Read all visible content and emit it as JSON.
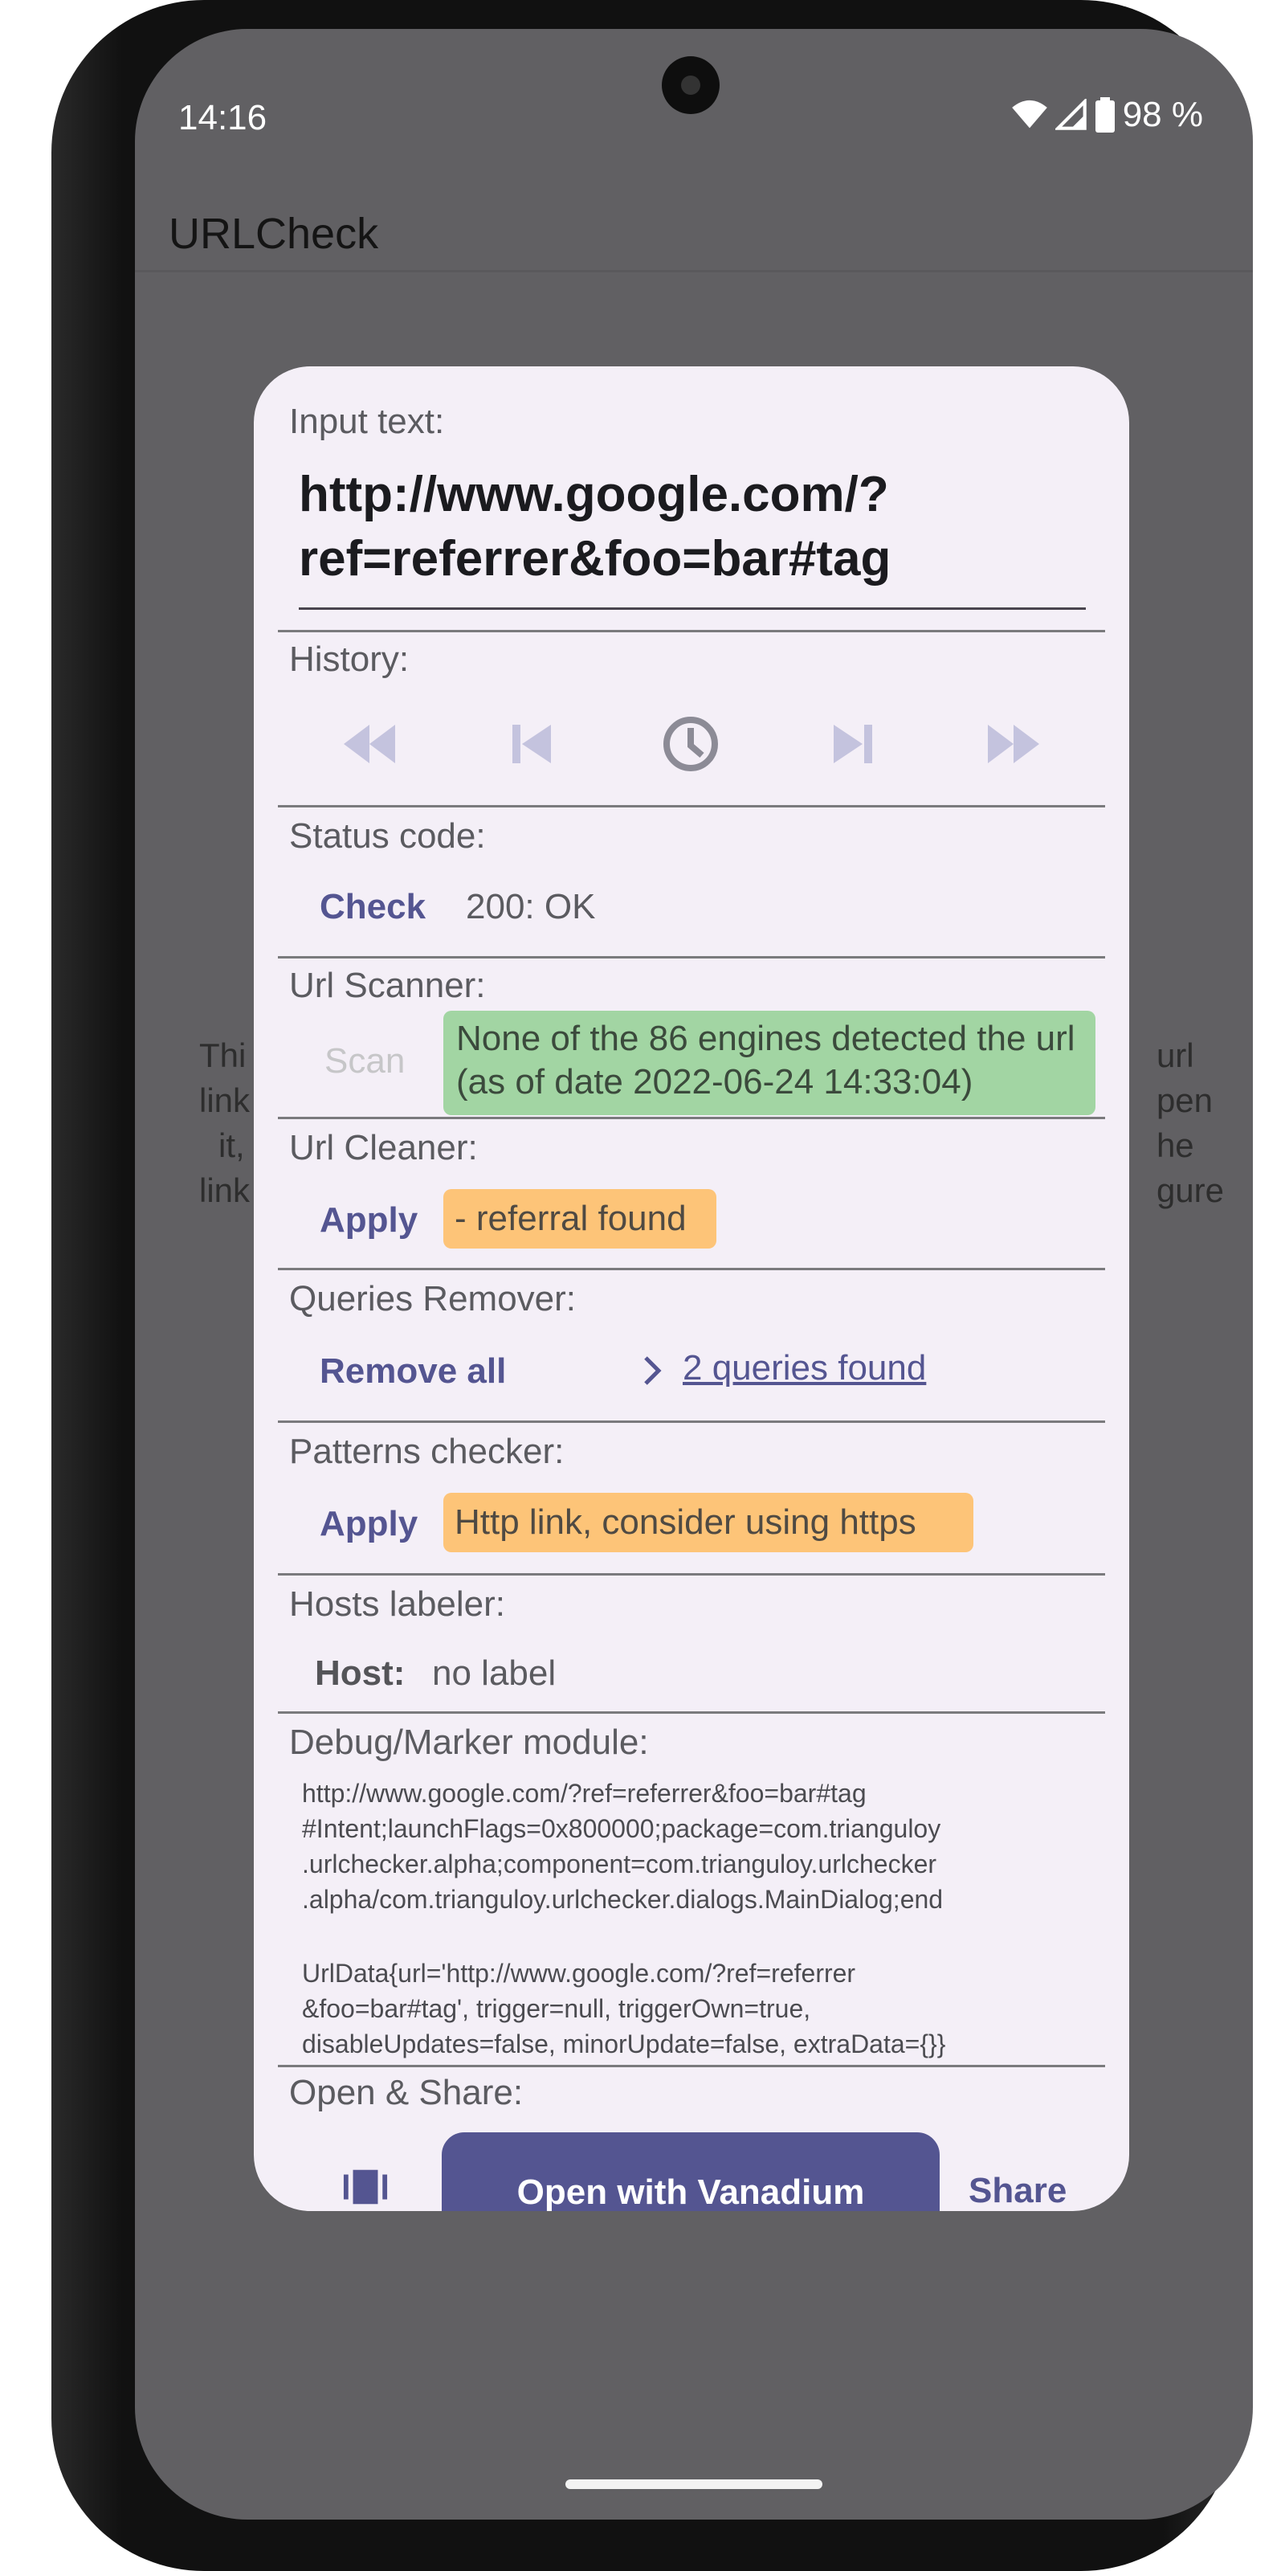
{
  "status_bar": {
    "time": "14:16",
    "battery": "98 %"
  },
  "app_bar": {
    "title": "URLCheck"
  },
  "background_text": {
    "left_lines": [
      "Thi",
      "link",
      "it,",
      "link"
    ],
    "right_lines": [
      "url",
      "pen",
      "he",
      "gure"
    ]
  },
  "dialog": {
    "input": {
      "label": "Input text:",
      "value": "http://www.google.com/?ref=referrer&foo=bar#tag"
    },
    "history": {
      "label": "History:"
    },
    "status_code": {
      "label": "Status code:",
      "button": "Check",
      "result": "200: OK"
    },
    "url_scanner": {
      "label": "Url Scanner:",
      "button": "Scan",
      "result": "None of the 86 engines detected the url (as of date 2022-06-24 14:33:04)"
    },
    "url_cleaner": {
      "label": "Url Cleaner:",
      "button": "Apply",
      "result": "- referral found"
    },
    "queries_remover": {
      "label": "Queries Remover:",
      "button": "Remove all",
      "result": "2 queries found"
    },
    "patterns_checker": {
      "label": "Patterns checker:",
      "button": "Apply",
      "result": "Http link, consider using https"
    },
    "hosts_labeler": {
      "label": "Hosts labeler:",
      "host_label": "Host:",
      "host_value": "no label"
    },
    "debug": {
      "label": "Debug/Marker module:",
      "intent": "http://www.google.com/?ref=referrer&foo=bar#tag\n#Intent;launchFlags=0x800000;package=com.trianguloy\n.urlchecker.alpha;component=com.trianguloy.urlchecker\n.alpha/com.trianguloy.urlchecker.dialogs.MainDialog;end",
      "urldata": "UrlData{url='http://www.google.com/?ref=referrer\n&foo=bar#tag', trigger=null, triggerOwn=true,\ndisableUpdates=false, minorUpdate=false, extraData={}}"
    },
    "open_share": {
      "label": "Open & Share:",
      "open_button": "Open with Vanadium",
      "share_button": "Share"
    }
  },
  "colors": {
    "accent": "#545591",
    "green_chip": "#a2d5a3",
    "orange_chip": "#fdc478",
    "dialog_bg": "#f4eff7"
  },
  "icons": [
    "wifi-icon",
    "signal-icon",
    "battery-icon",
    "rewind-icon",
    "skip-previous-icon",
    "history-icon",
    "skip-next-icon",
    "fast-forward-icon",
    "chevron-right-icon",
    "app-switch-icon"
  ]
}
